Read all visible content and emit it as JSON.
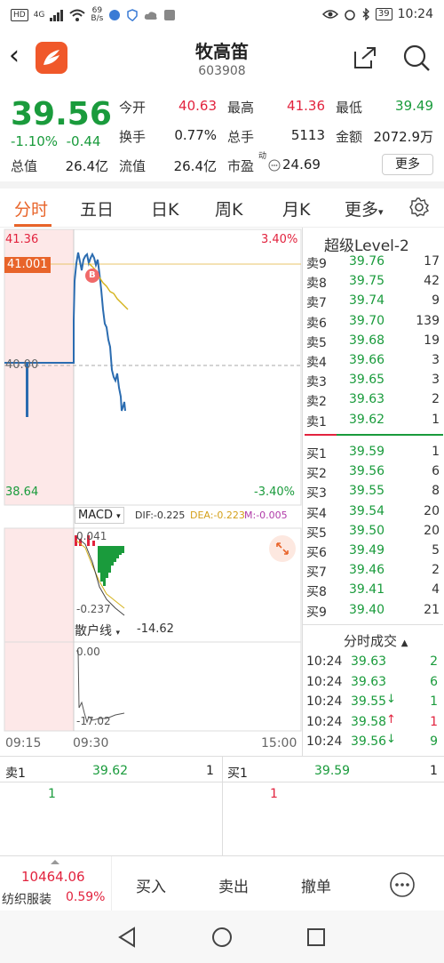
{
  "status_bar": {
    "hd": "HD",
    "net": "4G",
    "speed_value": "69",
    "speed_unit": "B/s",
    "battery": "39",
    "time": "10:24"
  },
  "header": {
    "title": "牧高笛",
    "code": "603908"
  },
  "quote": {
    "price": "39.56",
    "change_pct": "-1.10%",
    "change_abs": "-0.44",
    "fields": {
      "open_label": "今开",
      "open": "40.63",
      "high_label": "最高",
      "high": "41.36",
      "low_label": "最低",
      "low": "39.49",
      "turnover_label": "换手",
      "turnover": "0.77%",
      "volume_label": "总手",
      "volume": "5113",
      "amount_label": "金额",
      "amount": "2072.9万",
      "mktcap_label": "总值",
      "mktcap": "26.4亿",
      "float_label": "流值",
      "float": "26.4亿",
      "pe_label": "市盈",
      "pe_sup": "动",
      "pe": "24.69"
    },
    "more_label": "更多"
  },
  "tabs": [
    "分时",
    "五日",
    "日K",
    "周K",
    "月K",
    "更多"
  ],
  "chart": {
    "high_price": "41.36",
    "high_pct": "3.40%",
    "low_price": "38.64",
    "low_pct": "-3.40%",
    "mid_price": "40.00",
    "cursor_price": "41.001",
    "buy_marker": "B",
    "macd_label": "MACD",
    "dif": "DIF:-0.225",
    "dea": "DEA:-0.223",
    "m": "M:-0.005",
    "macd_top": "0.041",
    "macd_bottom": "-0.237",
    "retail_label": "散户线",
    "retail_value": "-14.62",
    "retail_top": "0.00",
    "retail_bottom": "-17.02",
    "time_start": "09:15",
    "time_mid": "09:30",
    "time_end": "15:00",
    "colors": {
      "up": "#e2233e",
      "down": "#1a9b3c",
      "price_line": "#2b6cb0",
      "avg_line": "#d4b21a",
      "accent": "#e8642a"
    }
  },
  "level2": {
    "title": "超级Level-2",
    "asks": [
      {
        "label": "卖9",
        "price": "39.76",
        "vol": "17"
      },
      {
        "label": "卖8",
        "price": "39.75",
        "vol": "42"
      },
      {
        "label": "卖7",
        "price": "39.74",
        "vol": "9"
      },
      {
        "label": "卖6",
        "price": "39.70",
        "vol": "139"
      },
      {
        "label": "卖5",
        "price": "39.68",
        "vol": "19"
      },
      {
        "label": "卖4",
        "price": "39.66",
        "vol": "3"
      },
      {
        "label": "卖3",
        "price": "39.65",
        "vol": "3"
      },
      {
        "label": "卖2",
        "price": "39.63",
        "vol": "2"
      },
      {
        "label": "卖1",
        "price": "39.62",
        "vol": "1"
      }
    ],
    "bids": [
      {
        "label": "买1",
        "price": "39.59",
        "vol": "1"
      },
      {
        "label": "买2",
        "price": "39.56",
        "vol": "6"
      },
      {
        "label": "买3",
        "price": "39.55",
        "vol": "8"
      },
      {
        "label": "买4",
        "price": "39.54",
        "vol": "20"
      },
      {
        "label": "买5",
        "price": "39.50",
        "vol": "20"
      },
      {
        "label": "买6",
        "price": "39.49",
        "vol": "5"
      },
      {
        "label": "买7",
        "price": "39.46",
        "vol": "2"
      },
      {
        "label": "买8",
        "price": "39.41",
        "vol": "4"
      },
      {
        "label": "买9",
        "price": "39.40",
        "vol": "21"
      }
    ],
    "trades_title": "分时成交",
    "trades": [
      {
        "time": "10:24",
        "price": "39.63",
        "arrow": "",
        "vol": "2",
        "dir": "down",
        "vdir": "down"
      },
      {
        "time": "10:24",
        "price": "39.63",
        "arrow": "",
        "vol": "6",
        "dir": "down",
        "vdir": "down"
      },
      {
        "time": "10:24",
        "price": "39.55",
        "arrow": "↓",
        "vol": "1",
        "dir": "down",
        "vdir": "down"
      },
      {
        "time": "10:24",
        "price": "39.58",
        "arrow": "↑",
        "vol": "1",
        "dir": "down",
        "vdir": "up"
      },
      {
        "time": "10:24",
        "price": "39.56",
        "arrow": "↓",
        "vol": "9",
        "dir": "down",
        "vdir": "down"
      }
    ]
  },
  "bidask": {
    "ask_label": "卖1",
    "ask_price": "39.62",
    "ask_vol": "1",
    "ask_count": "1",
    "bid_label": "买1",
    "bid_price": "39.59",
    "bid_vol": "1",
    "bid_count": "1"
  },
  "tradebar": {
    "index_value": "10464.06",
    "index_name": "纺织服装",
    "index_pct": "0.59%",
    "buy": "买入",
    "sell": "卖出",
    "cancel": "撤单"
  }
}
